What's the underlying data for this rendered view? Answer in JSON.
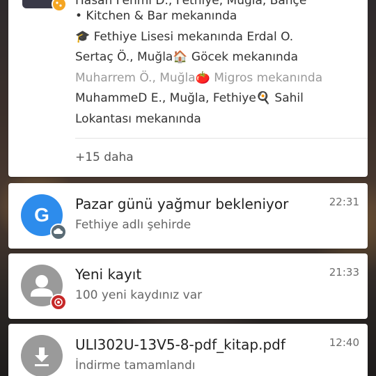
{
  "notifications": {
    "foursquare": {
      "top_line_cut": "Hasan Fehmi D., Fethiye, Muğla, Bahçe",
      "lines": [
        {
          "emoji": "fork-knife-icon",
          "text": "• Kitchen & Bar mekanında"
        },
        {
          "emoji": "graduation-cap-icon",
          "text": "🎓 Fethiye Lisesi mekanında Erdal O."
        },
        {
          "emoji": "house-icon",
          "text": "Sertaç Ö., Muğla🏠 Göcek mekanında"
        },
        {
          "emoji": "tomato-icon",
          "text": "Muharrem Ö., Muğla🍅 Migros mekanında"
        },
        {
          "emoji": "frying-pan-icon",
          "text": "MuhammeD E., Muğla, Fethiye🍳 Sahil"
        },
        {
          "emoji": "",
          "text": "Lokantası mekanında"
        }
      ],
      "more": "+15 daha",
      "badge_color": "#f5a623"
    },
    "weather": {
      "icon_letter": "G",
      "title": "Pazar günü yağmur bekleniyor",
      "subtitle": "Fethiye adlı şehirde",
      "time": "22:31",
      "icon_color": "#2d8cec"
    },
    "call": {
      "title": "Yeni kayıt",
      "subtitle": "100 yeni kaydınız var",
      "time": "21:33",
      "badge_color": "#c62828"
    },
    "download": {
      "title": "ULI302U-13V5-8-pdf_kitap.pdf",
      "subtitle": "İndirme tamamlandı",
      "time": "12:40"
    }
  }
}
